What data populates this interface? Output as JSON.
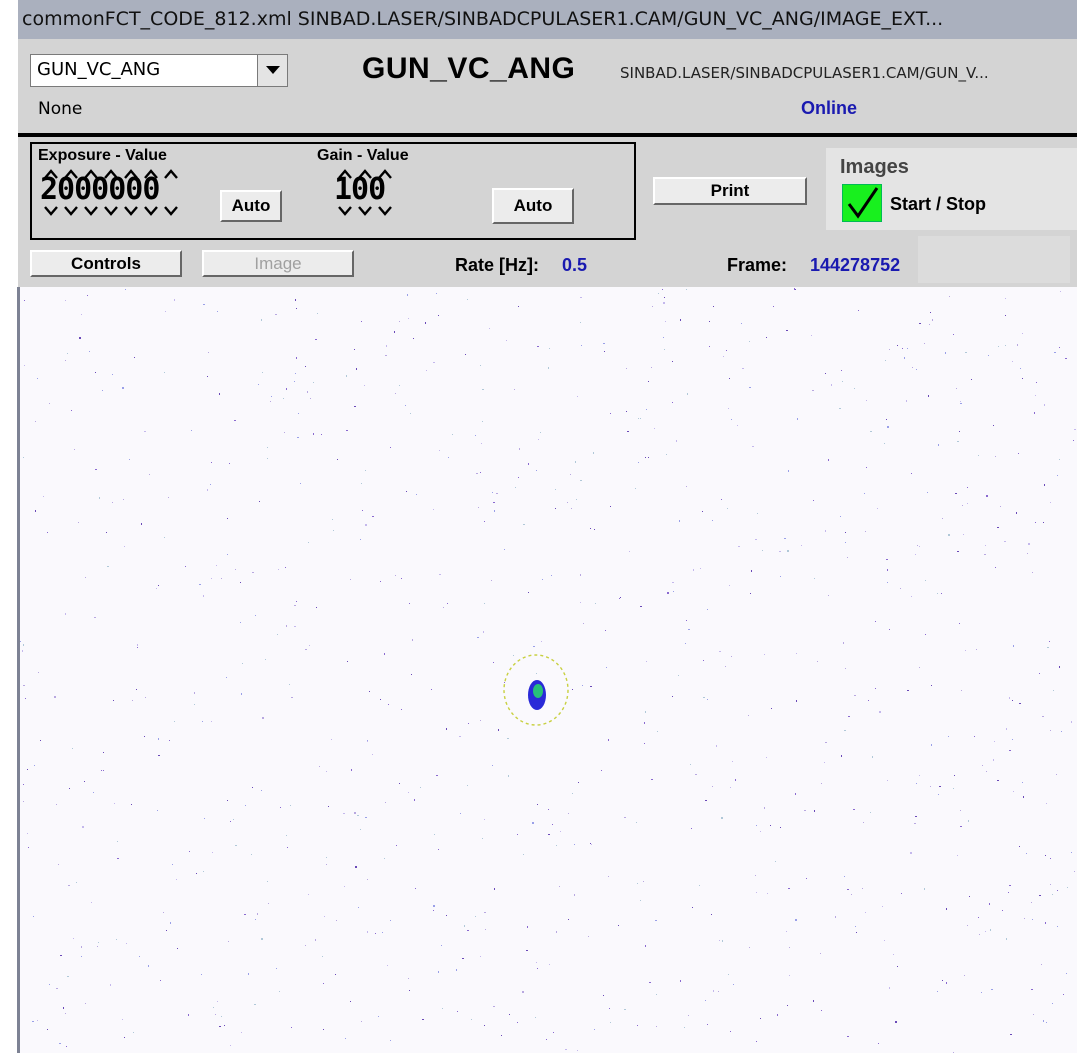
{
  "window": {
    "title": "commonFCT_CODE_812.xml  SINBAD.LASER/SINBADCPULASER1.CAM/GUN_VC_ANG/IMAGE_EXT..."
  },
  "header": {
    "selector_value": "GUN_VC_ANG",
    "status_left": "None",
    "device_title": "GUN_VC_ANG",
    "device_address": "SINBAD.LASER/SINBADCPULASER1.CAM/GUN_V...",
    "connection_status": "Online"
  },
  "controls": {
    "exposure_label": "Exposure - Value",
    "exposure_value": "2000000",
    "gain_label": "Gain - Value",
    "gain_value": "100",
    "auto_label": "Auto",
    "print_label": "Print",
    "controls_tab": "Controls",
    "image_tab": "Image"
  },
  "images": {
    "title": "Images",
    "toggle_label": "Start / Stop",
    "checked": true
  },
  "status": {
    "rate_label": "Rate [Hz]:",
    "rate_value": "0.5",
    "frame_label": "Frame:",
    "frame_value": "144278752"
  },
  "colors": {
    "accent_blue": "#1a1ab0",
    "check_green": "#18f01e",
    "title_bar": "#aab0be",
    "panel_gray": "#d4d4d4",
    "image_background": "#faf9fd",
    "beam_spot": "#2a2ad8",
    "fit_ellipse": "#c8d040"
  },
  "icons": {
    "combo_arrow": "chevron-down-icon",
    "check": "checkmark-icon"
  }
}
